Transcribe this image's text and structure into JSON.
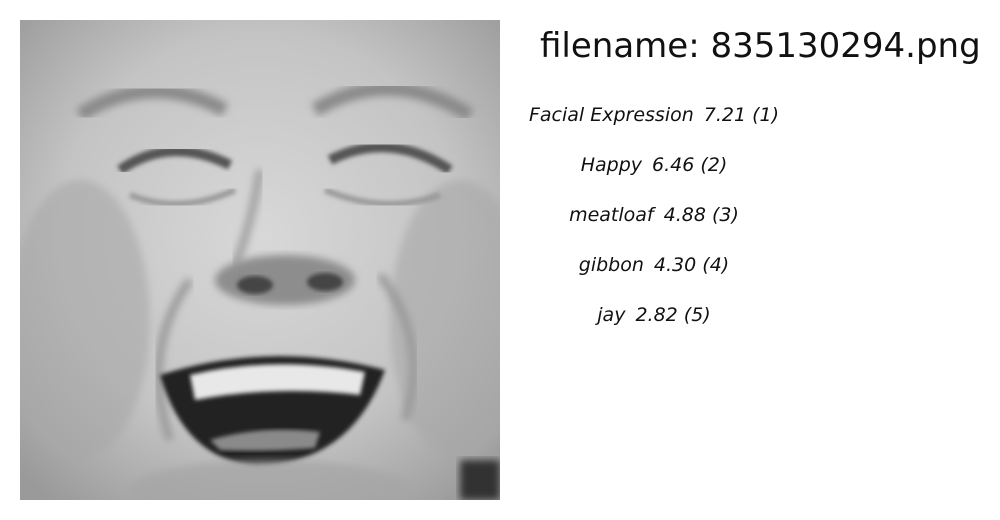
{
  "image": {
    "description_icon": "face-photo-icon"
  },
  "header": {
    "filename": "filename: 835130294.png"
  },
  "predictions": [
    {
      "label": "Facial Expression",
      "score": "7.21",
      "rank": "(1)"
    },
    {
      "label": "Happy",
      "score": "6.46",
      "rank": "(2)"
    },
    {
      "label": "meatloaf",
      "score": "4.88",
      "rank": "(3)"
    },
    {
      "label": "gibbon",
      "score": "4.30",
      "rank": "(4)"
    },
    {
      "label": "jay",
      "score": "2.82",
      "rank": "(5)"
    }
  ]
}
